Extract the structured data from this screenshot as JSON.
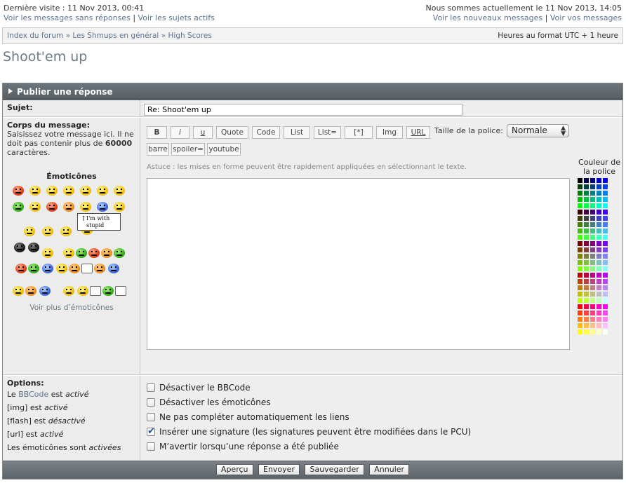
{
  "top": {
    "last_visit": "Dernière visite : 11 Nov 2013, 00:41",
    "unanswered": "Voir les messages sans réponses",
    "active": "Voir les sujets actifs",
    "now": "Nous sommes actuellement le 11 Nov 2013, 14:05",
    "new_messages": "Voir les nouveaux messages",
    "your_messages": "Voir vos messages",
    "sep": "|"
  },
  "nav": {
    "crumbs": [
      "Index du forum",
      "Les Shmups en général",
      "High Scores"
    ],
    "crumb_sep": "»",
    "timezone": "Heures au format UTC + 1 heure"
  },
  "page_title": "Shoot'em up",
  "panel": {
    "heading": "Publier une réponse",
    "subject_label": "Sujet:",
    "subject_value": "Re: Shoot'em up",
    "body_label": "Corps du message:",
    "body_help_1": "Saisissez votre message ici. Il ne doit pas contenir plus de ",
    "body_help_num": "60000",
    "body_help_2": " caractères.",
    "emoticons_title": "Émoticônes",
    "emoticons_more": "Voir plus d’émoticônes",
    "sign_text_1": "I'm with",
    "sign_text_2": "stupid",
    "toolbar": {
      "row1": [
        "B",
        "i",
        "u",
        "Quote",
        "Code",
        "List",
        "List=",
        "[*]",
        "Img",
        "URL"
      ],
      "row2": [
        "barre",
        "spoiler=",
        "youtube"
      ],
      "font_size_label": "Taille de la police:",
      "font_size_value": "Normale"
    },
    "hint": "Astuce : les mises en forme peuvent être rapidement appliquées en sélectionnant le texte.",
    "color_title_1": "Couleur de",
    "color_title_2": "la police",
    "options_label": "Options:",
    "options_status": {
      "bbcode_pre": "Le ",
      "bbcode_link": "BBCode",
      "bbcode_mid": " est ",
      "bbcode_state": "activé",
      "img_pre": "[img] est ",
      "img_state": "activé",
      "flash_pre": "[flash] est ",
      "flash_state": "désactivé",
      "url_pre": "[url] est ",
      "url_state": "activé",
      "smilies_pre": "Les émoticônes sont ",
      "smilies_state": "activées"
    },
    "checkboxes": [
      {
        "label": "Désactiver le BBCode",
        "checked": false
      },
      {
        "label": "Désactiver les émoticônes",
        "checked": false
      },
      {
        "label": "Ne pas compléter automatiquement les liens",
        "checked": false
      },
      {
        "label": "Insérer une signature (les signatures peuvent être modifiées dans le PCU)",
        "checked": true
      },
      {
        "label": "M’avertir lorsqu’une réponse a été publiée",
        "checked": false
      }
    ],
    "buttons": {
      "preview": "Aperçu",
      "send": "Envoyer",
      "save": "Sauvegarder",
      "cancel": "Annuler"
    }
  },
  "colors": {
    "accent_link": "#5c7391",
    "panel_header": "#5f666c"
  }
}
